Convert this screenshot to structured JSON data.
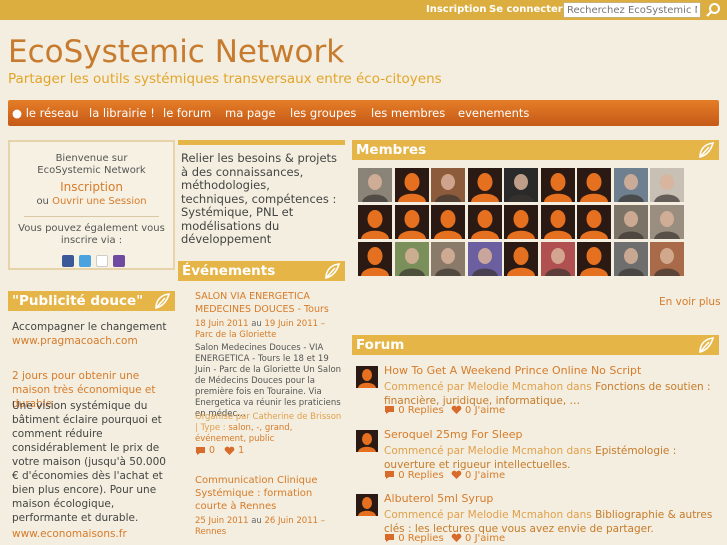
{
  "topbar": {
    "signup": "Inscription",
    "login": "Se connecter",
    "search_placeholder": "Recherchez EcoSystemic Network"
  },
  "header": {
    "title": "EcoSystemic Network",
    "tagline": "Partager les outils systémiques transversaux entre éco-citoyens"
  },
  "nav": [
    "● le réseau",
    "la librairie !",
    "le forum",
    "ma page",
    "les groupes",
    "les membres",
    "evenements"
  ],
  "welcome": {
    "line1": "Bienvenue sur",
    "line2": "EcoSystemic Network",
    "signup": "Inscription",
    "or": "ou",
    "open_session": "Ouvrir une Session",
    "also1": "Vous pouvez également vous",
    "also2": "inscrire via :"
  },
  "pub": {
    "heading": "\"Publicité douce\"",
    "p1": "Accompagner le changement",
    "link1": "www.pragmacoach.com",
    "p2_title": "2 jours pour obtenir une maison très économique et durable",
    "p2_body": "Une vision systémique du bâtiment éclaire pourquoi et comment réduire considérablement le prix de votre maison (jusqu'à 50.000 € d'économies dès l'achat et bien plus encore). Pour une maison écologique, performante et durable.",
    "link2": "www.economaisons.fr"
  },
  "mid": {
    "description": "Relier les besoins & projets à des connaissances, méthodologies, techniques, compétences : Systémique, PNL et modélisations du développement",
    "events_heading": "Événements",
    "events": [
      {
        "title": "SALON VIA ENERGETICA MEDECINES DOUCES - Tours",
        "date_from": "18 Juin 2011",
        "date_sep": "au",
        "date_to": "19 Juin 2011",
        "location": "– Parc de la Gloriette",
        "body": "Salon Medecines Douces - VIA ENERGETICA - Tours le 18 et 19 Juin - Parc de la Gloriette Un Salon de Médecins Douces pour la première fois en Touraine. Via Energetica va réunir les praticiens en médec…",
        "organizer_prefix": "Organisé par Catherine de Brisson",
        "type_label": "| Type :",
        "tags": "salon, -, grand, événement, public",
        "comments": "0",
        "likes": "1"
      },
      {
        "title": "Communication Clinique Systémique : formation courte à Rennes",
        "date_from": "25 Juin 2011",
        "date_sep": "au",
        "date_to": "26 Juin 2011",
        "location": "– Rennes"
      }
    ]
  },
  "members": {
    "heading": "Membres",
    "see_more": "En voir plus"
  },
  "forum": {
    "heading": "Forum",
    "started_by": "Commencé par",
    "in": "dans",
    "replies_label": "Replies",
    "like_label": "J'aime",
    "topics": [
      {
        "title": "How To Get A Weekend Prince Online No Script",
        "author": "Melodie Mcmahon",
        "category": "Fonctions de soutien : financière, juridique, informatique, …",
        "replies": "0",
        "likes": "0"
      },
      {
        "title": "Seroquel 25mg For Sleep",
        "author": "Melodie Mcmahon",
        "category": "Epistémologie : ouverture et rigueur intellectuelles.",
        "replies": "0",
        "likes": "0"
      },
      {
        "title": "Albuterol 5ml Syrup",
        "author": "Melodie Mcmahon",
        "category": "Bibliographie & autres clés : les lectures que vous avez envie de partager.",
        "replies": "0",
        "likes": "0"
      }
    ]
  },
  "colors": {
    "accent": "#d77b2a",
    "heading": "#e5b547",
    "nav": "#d96a20",
    "bg": "#f3eedf"
  }
}
